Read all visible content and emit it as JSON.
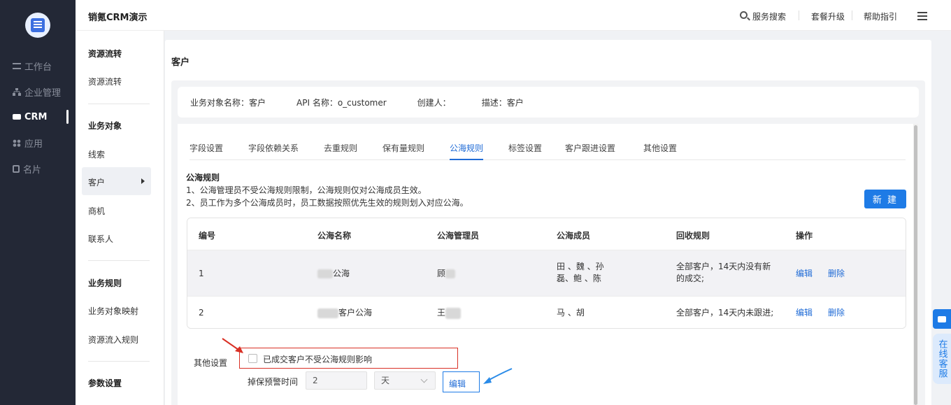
{
  "app": {
    "title": "销氪CRM演示"
  },
  "leftnav": {
    "items": [
      {
        "label": "工作台",
        "icon": "list-icon"
      },
      {
        "label": "企业管理",
        "icon": "org-icon"
      },
      {
        "label": "CRM",
        "icon": "crm-icon"
      },
      {
        "label": "应用",
        "icon": "apps-icon"
      },
      {
        "label": "名片",
        "icon": "card-icon"
      }
    ],
    "active": "CRM"
  },
  "header": {
    "search_label": "服务搜索",
    "upgrade_label": "套餐升级",
    "help_label": "帮助指引"
  },
  "subnav": {
    "sections": [
      {
        "title": "资源流转",
        "items": [
          "资源流转"
        ]
      },
      {
        "title": "业务对象",
        "items": [
          "线索",
          "客户",
          "商机",
          "联系人"
        ]
      },
      {
        "title": "业务规则",
        "items": [
          "业务对象映射",
          "资源流入规则"
        ]
      },
      {
        "title": "参数设置",
        "items": []
      }
    ],
    "active": "客户"
  },
  "page": {
    "title": "客户",
    "info": {
      "object_name": "业务对象名称：客户",
      "api_name": "API 名称：o_customer",
      "creator": "创建人：",
      "description": "描述：客户"
    },
    "tabs": [
      "字段设置",
      "字段依赖关系",
      "去重规则",
      "保有量规则",
      "公海规则",
      "标签设置",
      "客户跟进设置",
      "其他设置"
    ],
    "active_tab": "公海规则",
    "rules": {
      "title": "公海规则",
      "line1": "1、公海管理员不受公海规则限制，公海规则仅对公海成员生效。",
      "line2": "2、员工作为多个公海成员时，员工数据按照优先生效的规则划入对应公海。"
    },
    "new_button": "新 建",
    "table": {
      "columns": [
        "编号",
        "公海名称",
        "公海管理员",
        "公海成员",
        "回收规则",
        "操作"
      ],
      "rows": [
        {
          "id": "1",
          "name": "公海",
          "admin": "顾",
          "members_line1": "田  、魏  、孙",
          "members_line2": "磊、鲍  、陈",
          "rule_line1": "全部客户，14天内没有新",
          "rule_line2": "的成交;",
          "edit": "编辑",
          "delete": "删除"
        },
        {
          "id": "2",
          "name": "客户公海",
          "admin": "王",
          "members_line1": "马  、胡",
          "members_line2": "",
          "rule_line1": "全部客户，14天内未跟进;",
          "rule_line2": "",
          "edit": "编辑",
          "delete": "删除"
        }
      ]
    },
    "other_settings": {
      "label": "其他设置",
      "checkbox_label": "已成交客户不受公海规则影响",
      "checkbox_checked": false,
      "warning_label": "掉保预警时间",
      "warning_value": "2",
      "unit_value": "天",
      "edit_button": "编辑"
    }
  },
  "floating": {
    "service_label": "在线客服"
  },
  "colors": {
    "primary": "#1e7be6",
    "nav_bg": "#232836",
    "highlight_red": "#d93025"
  }
}
